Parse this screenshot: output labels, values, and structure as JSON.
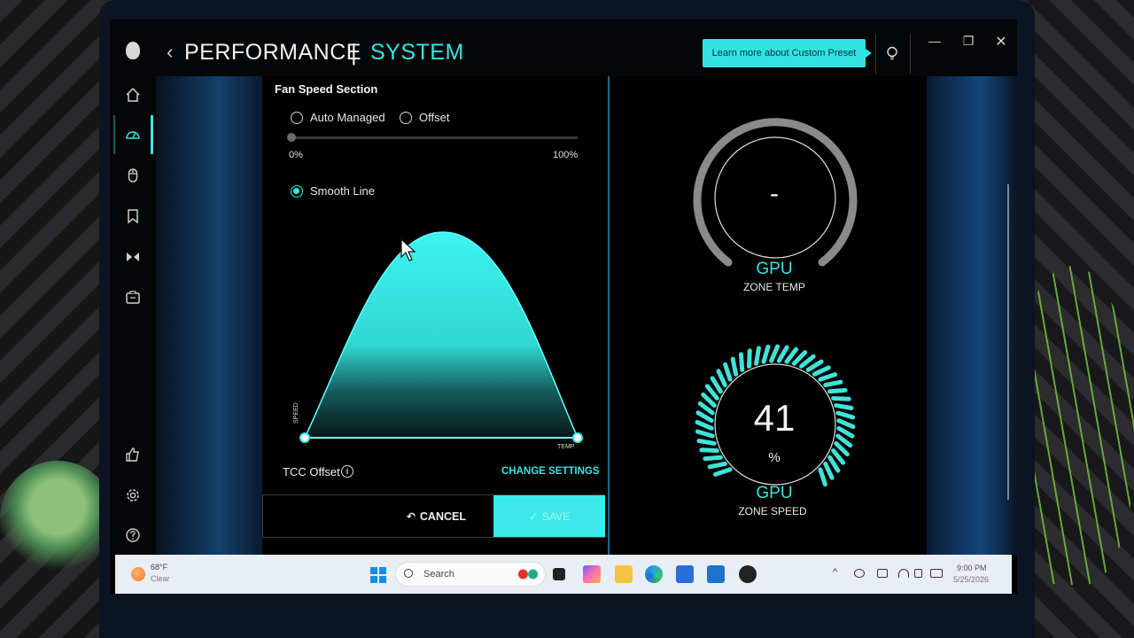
{
  "window": {
    "back_glyph": "‹",
    "title_section": "PERFORMANCE",
    "title_separator": "|",
    "title_subsection": "SYSTEM",
    "tooltip": "Learn more about Custom Preset",
    "controls": {
      "minimize": "—",
      "maximize": "❐",
      "close": "✕"
    }
  },
  "sidebar": {
    "items": [
      {
        "id": "home",
        "icon": "home-icon"
      },
      {
        "id": "performance",
        "icon": "speedometer-icon",
        "active": true
      },
      {
        "id": "mouse",
        "icon": "mouse-icon"
      },
      {
        "id": "library",
        "icon": "bookmark-icon"
      },
      {
        "id": "accessories",
        "icon": "earbuds-icon"
      },
      {
        "id": "console",
        "icon": "console-icon"
      }
    ],
    "bottom_items": [
      {
        "id": "feedback",
        "icon": "thumbs-up-icon"
      },
      {
        "id": "settings",
        "icon": "gear-icon"
      },
      {
        "id": "help",
        "icon": "help-icon"
      }
    ]
  },
  "fan_speed": {
    "section_title": "Fan Speed Section",
    "options": {
      "auto": "Auto Managed",
      "offset": "Offset"
    },
    "slider": {
      "min_label": "0%",
      "max_label": "100%",
      "value": 0
    },
    "smooth_line_label": "Smooth Line",
    "curve": {
      "y_axis_label": "SPEED",
      "x_axis_label": "TEMP."
    },
    "tcc_label": "TCC Offset",
    "tcc_info": "i",
    "change_settings": "CHANGE SETTINGS",
    "cancel_icon": "↶",
    "cancel": "CANCEL",
    "save_icon": "✓",
    "save": "SAVE"
  },
  "gauges": {
    "temp": {
      "value": "-",
      "label": "GPU",
      "sublabel": "ZONE TEMP"
    },
    "speed": {
      "value": "41",
      "unit": "%",
      "label": "GPU",
      "sublabel": "ZONE SPEED",
      "fraction": 0.41
    }
  },
  "taskbar": {
    "weather_temp": "68°F",
    "weather_desc": "Clear",
    "search_label": "Search",
    "tray_chevron": "^",
    "time": "9:00 PM",
    "date": "5/25/2026"
  },
  "colors": {
    "accent": "#35e6e6",
    "background": "#000000",
    "save_button": "#3ce9ea"
  }
}
